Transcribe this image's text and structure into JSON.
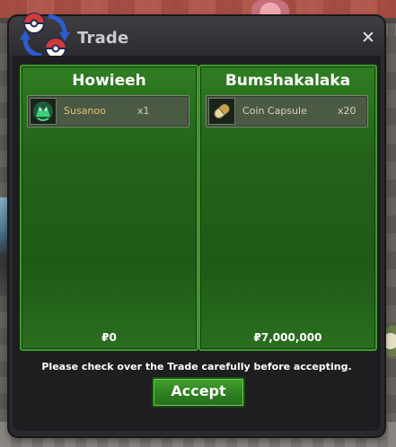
{
  "window": {
    "title": "Trade",
    "close_symbol": "✕",
    "icon": "trade-exchange-icon"
  },
  "trader_left": {
    "name": "Howieeh",
    "item": {
      "name": "Susanoo",
      "quantity": "x1",
      "icon": "susanoo-icon"
    },
    "money": "₽0"
  },
  "trader_right": {
    "name": "Bumshakalaka",
    "item": {
      "name": "Coin Capsule",
      "quantity": "x20",
      "icon": "coin-capsule-icon"
    },
    "money": "₽7,000,000"
  },
  "notice": "Please check over the Trade carefully before accepting.",
  "accept_label": "Accept",
  "colors": {
    "panel_green": "#24631a",
    "accept_green": "#2f7f22",
    "window_dark": "#1e1e21",
    "item_name_gold": "#e0c07a"
  }
}
